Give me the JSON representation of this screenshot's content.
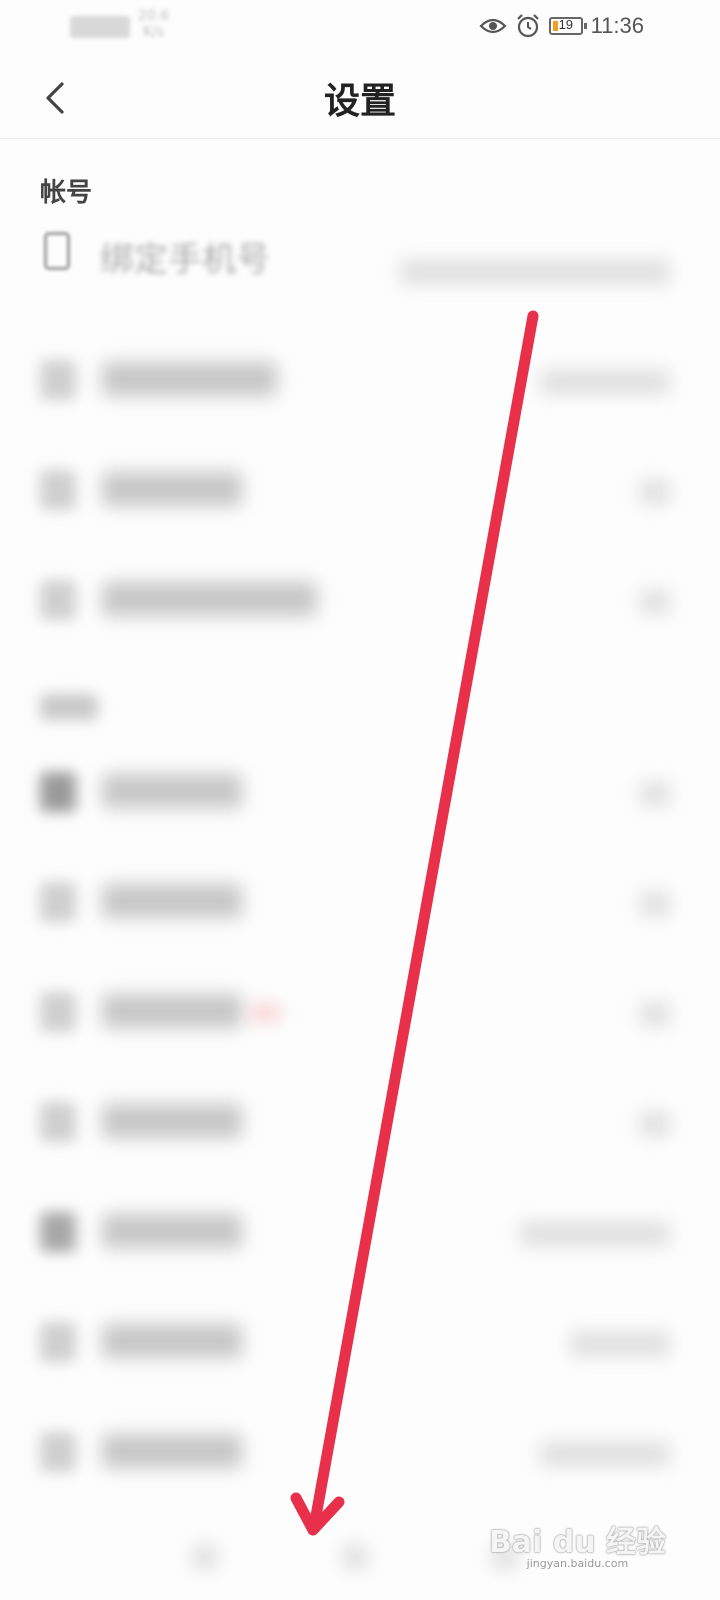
{
  "status_bar": {
    "net_speed": "20.6\nK/s",
    "net_speed_line1": "20.6",
    "net_speed_line2": "K/s",
    "battery": "19",
    "time": "11:36",
    "icons": [
      "wifi-icon",
      "eye-icon",
      "alarm-icon",
      "battery-icon"
    ]
  },
  "header": {
    "title": "设置",
    "back_icon": "chevron-left-icon"
  },
  "sections": [
    {
      "label": "帐号"
    }
  ],
  "account_rows": [
    {
      "label": "绑定手机号",
      "icon": "phone-icon"
    }
  ],
  "colors": {
    "arrow": "#e8304a",
    "background": "#fdfdfd"
  },
  "watermark": {
    "text": "Bai du 经验",
    "sub": "jingyan.baidu.com"
  }
}
